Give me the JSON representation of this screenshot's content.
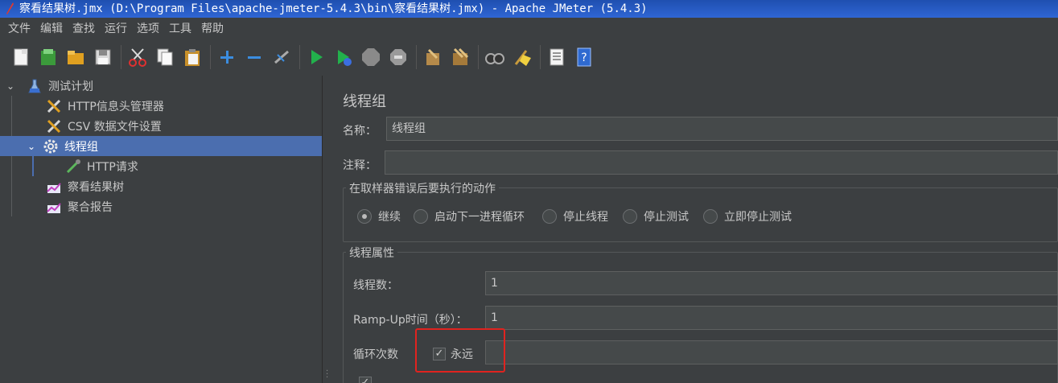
{
  "window": {
    "title": "察看结果树.jmx (D:\\Program Files\\apache-jmeter-5.4.3\\bin\\察看结果树.jmx) - Apache JMeter (5.4.3)"
  },
  "menu": [
    "文件",
    "编辑",
    "查找",
    "运行",
    "选项",
    "工具",
    "帮助"
  ],
  "toolbar": {
    "icons": [
      "new-icon",
      "templates-icon",
      "open-icon",
      "save-icon",
      "cut-icon",
      "copy-icon",
      "paste-icon",
      "expand-icon",
      "collapse-icon",
      "toggle-icon",
      "start-icon",
      "start-no-pause-icon",
      "stop-icon",
      "shutdown-icon",
      "clear-icon",
      "clear-all-icon",
      "search-icon",
      "reset-search-icon",
      "function-helper-icon",
      "help-icon"
    ]
  },
  "tree": {
    "items": [
      {
        "label": "测试计划",
        "icon": "test-plan-icon"
      },
      {
        "label": "HTTP信息头管理器",
        "icon": "config-tools-icon"
      },
      {
        "label": "CSV 数据文件设置",
        "icon": "config-tools-icon"
      },
      {
        "label": "线程组",
        "icon": "gear-icon"
      },
      {
        "label": "HTTP请求",
        "icon": "pipette-icon"
      },
      {
        "label": "察看结果树",
        "icon": "listener-icon"
      },
      {
        "label": "聚合报告",
        "icon": "listener-icon"
      }
    ]
  },
  "panel": {
    "title": "线程组",
    "name_label": "名称：",
    "name_value": "线程组",
    "comment_label": "注释：",
    "comment_value": "",
    "error_group_label": "在取样器错误后要执行的动作",
    "error_actions": [
      "继续",
      "启动下一进程循环",
      "停止线程",
      "停止测试",
      "立即停止测试"
    ],
    "error_selected": "继续",
    "props_group_label": "线程属性",
    "threads_label": "线程数：",
    "threads_value": "1",
    "rampup_label": "Ramp-Up时间（秒）：",
    "rampup_value": "1",
    "loop_label": "循环次数",
    "forever_label": "永远",
    "forever_checked": true,
    "loop_value": ""
  },
  "colors": {
    "background": "#3c3f41",
    "selection": "#4b6eaf",
    "titlebar": "#2f66d4",
    "highlight_box": "#e0231f"
  }
}
